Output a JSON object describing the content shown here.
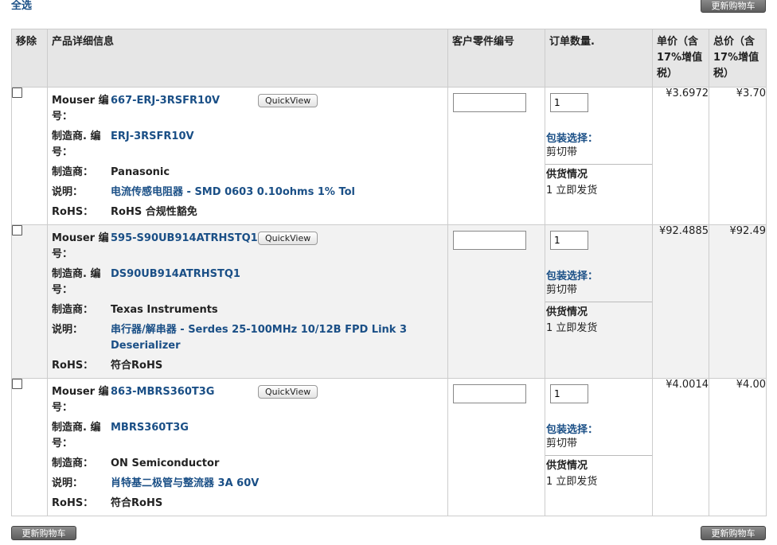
{
  "top": {
    "select_all": "全选",
    "update_cart": "更新购物车"
  },
  "bottom": {
    "update_cart_left": "更新购物车",
    "update_cart_right": "更新购物车"
  },
  "headers": {
    "remove": "移除",
    "product": "产品详细信息",
    "customer_part": "客户零件编号",
    "qty": "订单数量.",
    "unit_price": "单价（含17%增值税）",
    "total_price": "总价（含17%增值税）"
  },
  "labels": {
    "mouser_no": "Mouser 编号：",
    "mfr_no": "制造商. 编号：",
    "mfr": "制造商：",
    "desc": "说明：",
    "rohs": "RoHS：",
    "quickview": "QuickView",
    "packaging": "包装选择：",
    "availability": "供货情况"
  },
  "items": [
    {
      "mouser_no": "667-ERJ-3RSFR10V",
      "mfr_no": "ERJ-3RSFR10V",
      "mfr": "Panasonic",
      "desc": "电流传感电阻器 - SMD 0603 0.10ohms 1% Tol",
      "rohs": "RoHS 合规性豁免",
      "customer_part": "",
      "qty": "1",
      "packaging": "剪切带",
      "availability": "1 立即发货",
      "unit_price": "¥3.6972",
      "total_price": "¥3.70"
    },
    {
      "mouser_no": "595-S90UB914ATRHSTQ1",
      "mfr_no": "DS90UB914ATRHSTQ1",
      "mfr": "Texas Instruments",
      "desc": "串行器/解串器 - Serdes 25-100MHz 10/12B FPD Link 3 Deserializer",
      "rohs": "符合RoHS",
      "customer_part": "",
      "qty": "1",
      "packaging": "剪切带",
      "availability": "1 立即发货",
      "unit_price": "¥92.4885",
      "total_price": "¥92.49"
    },
    {
      "mouser_no": "863-MBRS360T3G",
      "mfr_no": "MBRS360T3G",
      "mfr": "ON Semiconductor",
      "desc": "肖特基二极管与整流器 3A 60V",
      "rohs": "符合RoHS",
      "customer_part": "",
      "qty": "1",
      "packaging": "剪切带",
      "availability": "1 立即发货",
      "unit_price": "¥4.0014",
      "total_price": "¥4.00"
    }
  ]
}
